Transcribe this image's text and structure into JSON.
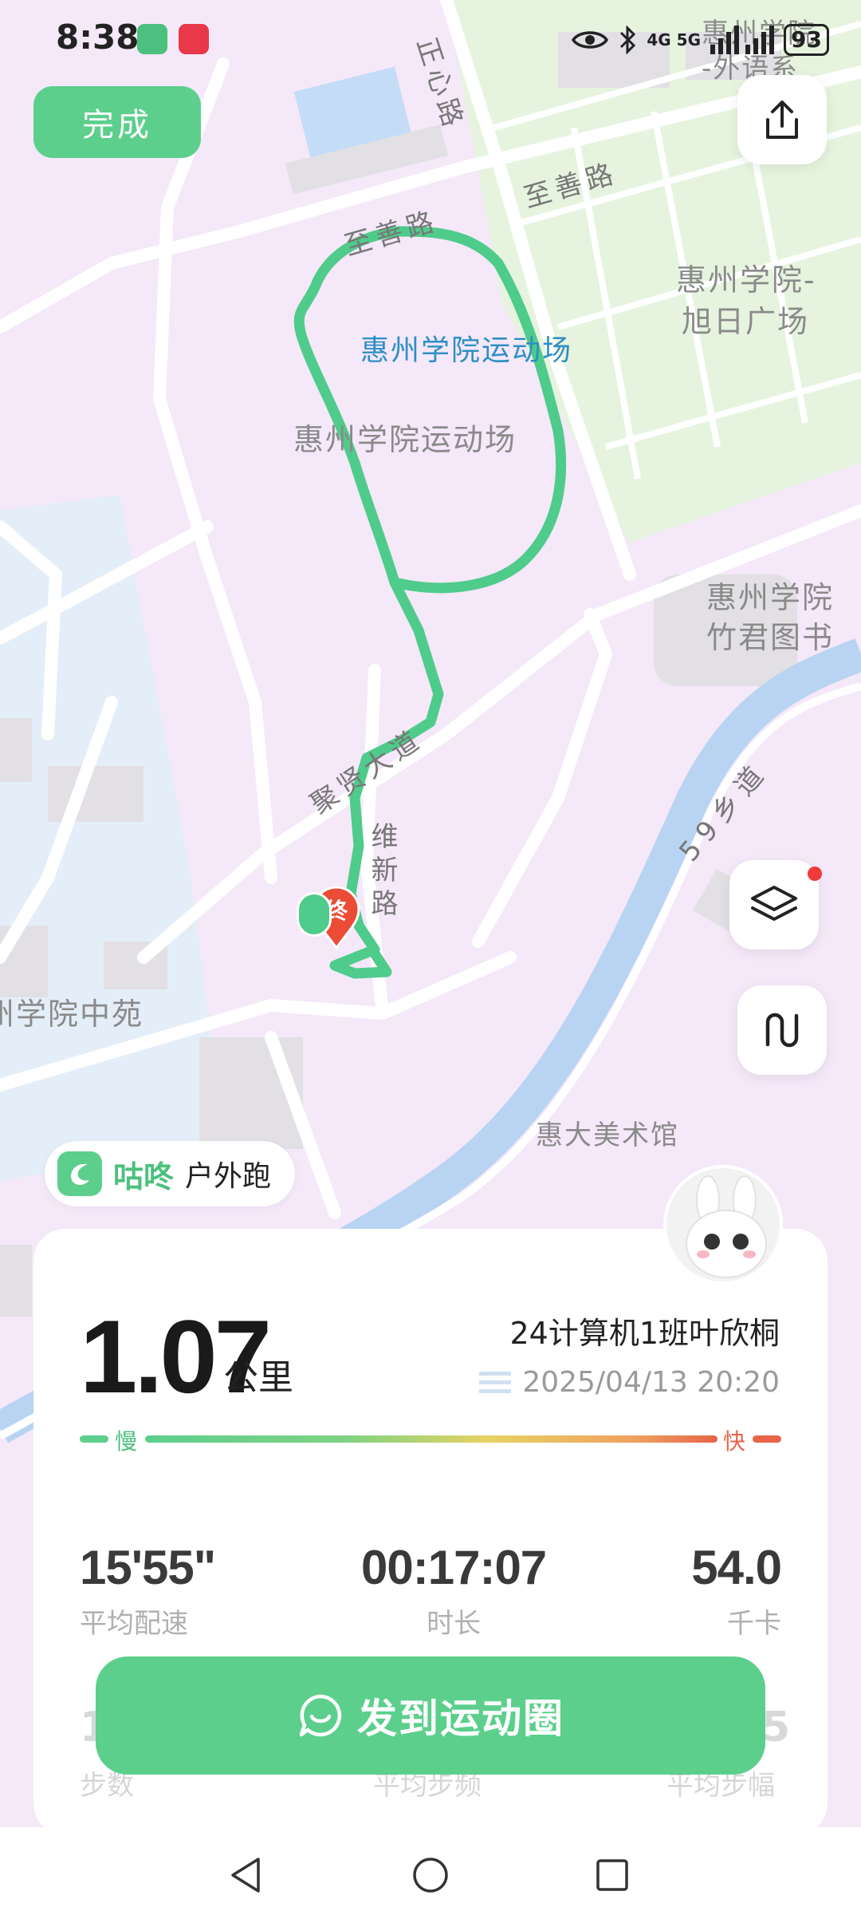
{
  "status_bar": {
    "time": "8:38",
    "network": "4G 5G",
    "battery": "93"
  },
  "map": {
    "labels": {
      "campus_top": "惠州学院",
      "school_foreign": "-外语系",
      "road_zhengxin": "正心路",
      "road_zhishan_1": "至善路",
      "road_zhishan_2": "至善路",
      "plaza_line1": "惠州学院-",
      "plaza_line2": "旭日广场",
      "stadium_blue": "惠州学院运动场",
      "stadium_gray": "惠州学院运动场",
      "library_line1": "惠州学院",
      "library_line2": "竹君图书",
      "road_juxian": "聚贤大道",
      "road_weixin": "维新路",
      "road_59": "59乡道",
      "zhongyuan": "州学院中苑",
      "art_museum": "惠大美术馆"
    },
    "end_marker": "终"
  },
  "header": {
    "done_label": "完成"
  },
  "brand": {
    "name": "咕咚",
    "activity": "户外跑"
  },
  "summary": {
    "distance": "1.07",
    "distance_unit": "公里",
    "user_name": "24计算机1班叶欣桐",
    "datetime": "2025/04/13 20:20",
    "pace_slow": "慢",
    "pace_fast": "快"
  },
  "stats": [
    {
      "value": "15'55\"",
      "label": "平均配速"
    },
    {
      "value": "00:17:07",
      "label": "时长"
    },
    {
      "value": "54.0",
      "label": "千卡"
    }
  ],
  "stats_row2": [
    {
      "value": "1",
      "label": "步数"
    },
    {
      "value": "",
      "label": "平均步频"
    },
    {
      "value": "5",
      "label": "平均步幅"
    }
  ],
  "share_button_label": "发到运动圈",
  "colors": {
    "accent": "#5ccf8c",
    "route": "#4fcb8b",
    "end_marker": "#ec4b36"
  }
}
